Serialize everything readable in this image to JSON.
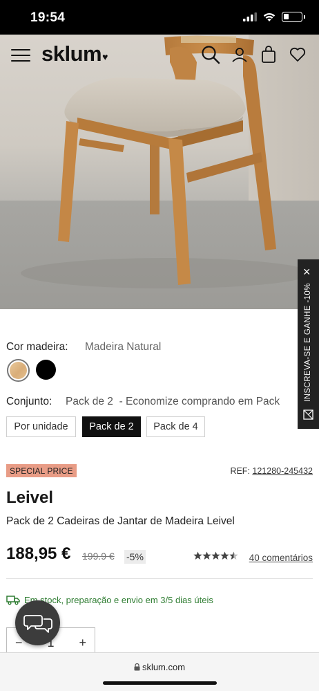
{
  "status": {
    "time": "19:54"
  },
  "header": {
    "logo": "sklum",
    "icons": [
      "menu-icon",
      "search-icon",
      "account-icon",
      "cart-icon",
      "heart-icon"
    ]
  },
  "gallery": {
    "slides": 8,
    "active_slide": 1
  },
  "side_tab": {
    "label": "INSCREVA-SE E GANHE -10%"
  },
  "wood_color": {
    "label": "Cor madeira:",
    "value": "Madeira Natural",
    "options": [
      "natural",
      "black"
    ],
    "selected": "natural"
  },
  "set": {
    "label": "Conjunto:",
    "value": "Pack de 2",
    "note": "- Economize comprando em Pack",
    "options": [
      "Por unidade",
      "Pack de 2",
      "Pack de 4"
    ],
    "selected": "Pack de 2"
  },
  "badge": "SPECIAL PRICE",
  "ref": {
    "label": "REF:",
    "value": "121280-245432"
  },
  "product": {
    "name": "Leivel",
    "subtitle": "Pack de 2 Cadeiras de Jantar de Madeira Leivel"
  },
  "pricing": {
    "price": "188,95 €",
    "old_price": "199.9 €",
    "discount": "-5%"
  },
  "rating": {
    "stars": 4.5,
    "reviews": "40 comentários"
  },
  "stock": {
    "text": "Em stock, preparação e envio em 3/5 dias úteis"
  },
  "quantity": {
    "minus": "−",
    "value": "1",
    "plus": "+"
  },
  "browser": {
    "url": "sklum.com"
  }
}
